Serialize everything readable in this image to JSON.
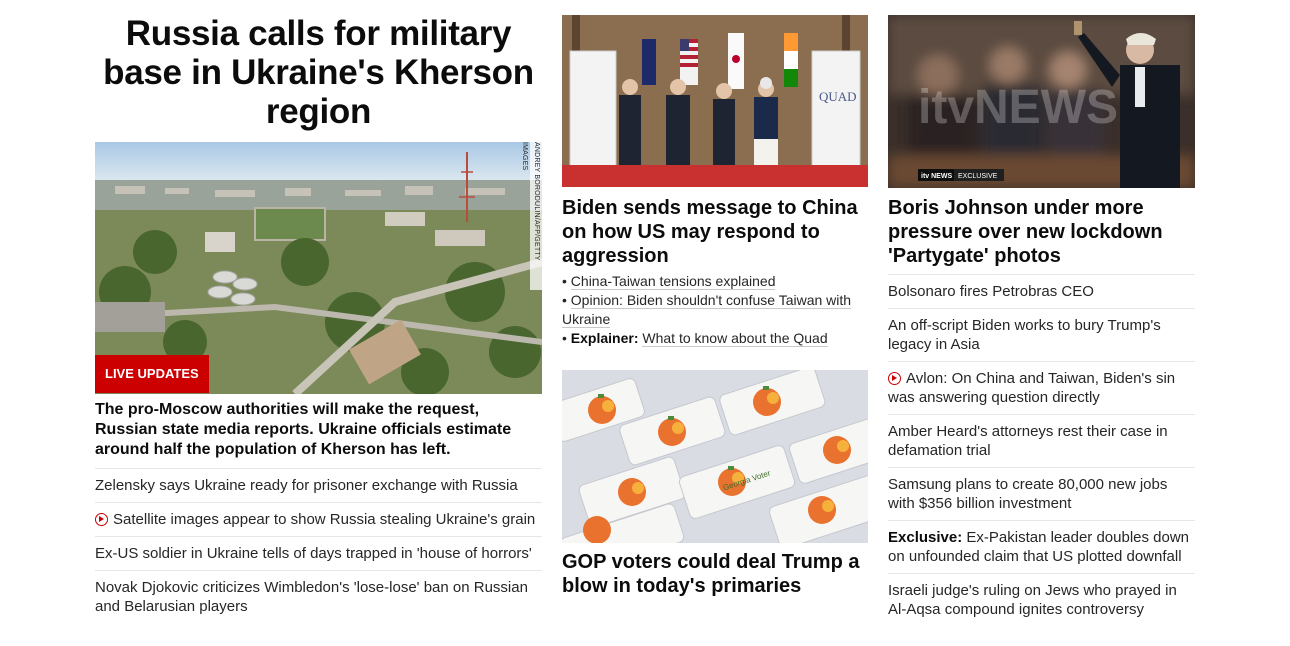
{
  "col1": {
    "headline": "Russia calls for military base in Ukraine's Kherson region",
    "badge": "LIVE UPDATES",
    "photo_credit": "ANDREY BORODULIN/AFP/GETTY IMAGES",
    "summary": "The pro-Moscow authorities will make the request, Russian state media reports. Ukraine officials estimate around half the population of Kherson has left.",
    "links": [
      {
        "text": "Zelensky says Ukraine ready for prisoner exchange with Russia",
        "video": false
      },
      {
        "text": "Satellite images appear to show Russia stealing Ukraine's grain",
        "video": true
      },
      {
        "text": "Ex-US soldier in Ukraine tells of days trapped in 'house of horrors'",
        "video": false
      },
      {
        "text": "Novak Djokovic criticizes Wimbledon's 'lose-lose' ban on Russian and Belarusian players",
        "video": false
      }
    ]
  },
  "col2": {
    "story1": {
      "headline": "Biden sends message to China on how US may respond to aggression",
      "quad_sign": "QUAD",
      "bullets": [
        {
          "prefix": "",
          "text": "China-Taiwan tensions explained"
        },
        {
          "prefix": "",
          "text": "Opinion: Biden shouldn't confuse Taiwan with Ukraine"
        },
        {
          "prefix": "Explainer:",
          "text": "What to know about the Quad"
        }
      ]
    },
    "story2": {
      "headline": "GOP voters could deal Trump a blow in today's primaries",
      "sticker_text": "Georgia Voter"
    }
  },
  "col3": {
    "story": {
      "headline": "Boris Johnson under more pressure over new lockdown 'Partygate' photos",
      "watermark": "itvNEWS",
      "tag_brand": "itv NEWS",
      "tag_label": "EXCLUSIVE"
    },
    "links": [
      {
        "prefix": "",
        "text": "Bolsonaro fires Petrobras CEO",
        "video": false
      },
      {
        "prefix": "",
        "text": "An off-script Biden works to bury Trump's legacy in Asia",
        "video": false
      },
      {
        "prefix": "",
        "text": "Avlon: On China and Taiwan, Biden's sin was answering question directly",
        "video": true
      },
      {
        "prefix": "",
        "text": "Amber Heard's attorneys rest their case in defamation trial",
        "video": false
      },
      {
        "prefix": "",
        "text": "Samsung plans to create 80,000 new jobs with $356 billion investment",
        "video": false
      },
      {
        "prefix": "Exclusive:",
        "text": "Ex-Pakistan leader doubles down on unfounded claim that US plotted downfall",
        "video": false
      },
      {
        "prefix": "",
        "text": "Israeli judge's ruling on Jews who prayed in Al-Aqsa compound ignites controversy",
        "video": false
      }
    ]
  },
  "colors": {
    "badge_red": "#cc0000",
    "text": "#0c0c0c",
    "divider": "#e6e6e6"
  }
}
